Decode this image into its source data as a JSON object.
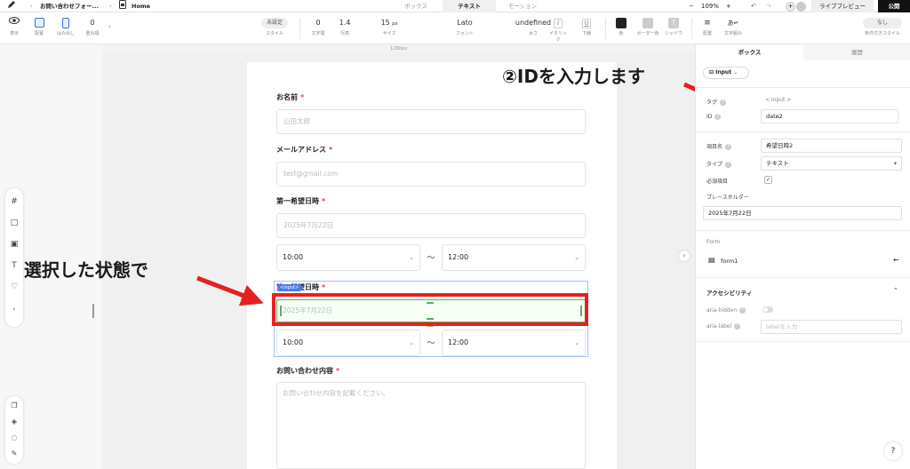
{
  "topbar": {
    "file_name": "お問い合わせフォー...",
    "page_name": "Home",
    "tabs": [
      "ボックス",
      "テキスト",
      "モーション"
    ],
    "active_tab": "テキスト",
    "zoom": "109%",
    "zoom_minus": "−",
    "zoom_plus": "+",
    "live_preview": "ライブプレビュー",
    "publish": "公開"
  },
  "toolbar": {
    "display_label": "表示",
    "layout_label": "配置",
    "overflow_label": "はみ出し",
    "stack_value": "0",
    "stack_label": "重ね順",
    "style_value": "未設定",
    "style_label": "スタイル",
    "letter_spacing_value": "0",
    "letter_spacing_label": "文字間",
    "line_height_value": "1.4",
    "line_height_label": "行高",
    "size_value": "15",
    "size_unit": "px",
    "size_label": "サイズ",
    "font_value": "Lato",
    "font_label": "フォント",
    "weight_value": "undefined",
    "weight_label": "太さ",
    "italic_label": "イタリック",
    "underline_label": "下線",
    "color_label": "色",
    "border_color_label": "ボーダー色",
    "shadow_label": "シャドウ",
    "align_label": "配置",
    "text_wrap_label": "文字組み",
    "condition_value": "なし",
    "condition_label": "条件付きスタイル"
  },
  "canvas": {
    "ruler_label": "1280px"
  },
  "form": {
    "name_label": "お名前",
    "name_placeholder": "山田太郎",
    "email_label": "メールアドレス",
    "email_placeholder": "test@gmail.com",
    "date1_label": "第一希望日時",
    "date1_placeholder": "2025年7月22日",
    "time1_start": "10:00",
    "time1_end": "12:00",
    "date2_label": "第二希望日時",
    "input_tag": "<input>",
    "date2_placeholder": "2025年7月22日",
    "time2_start": "10:00",
    "time2_end": "12:00",
    "tilde": "〜",
    "required_mark": "*",
    "content_label": "お問い合わせ内容",
    "content_placeholder": "お問い合わせ内容を記載ください。"
  },
  "annotations": {
    "step1": "①選択した状態で",
    "step2": "②IDを入力します"
  },
  "panel": {
    "tab_box": "ボックス",
    "tab_history": "履歴",
    "element_type": "Input",
    "tag_label": "タグ",
    "tag_value": "< input >",
    "id_label": "ID",
    "id_value": "date2",
    "field_name_label": "項目名",
    "field_name_value": "希望日時2",
    "type_label": "タイプ",
    "type_value": "テキスト",
    "required_label": "必須項目",
    "placeholder_label": "プレースホルダー",
    "placeholder_value": "2025年7月22日",
    "form_section": "Form",
    "form_name": "form1",
    "accessibility_section": "アクセシビリティ",
    "aria_hidden_label": "aria-hidden",
    "aria_label_label": "aria-label",
    "aria_label_placeholder": "labelを入力",
    "help": "?"
  },
  "colors": {
    "annotation_red": "#e62020",
    "selection_green": "#5bb05b",
    "selection_blue": "#4a7cf5",
    "required_red": "#e0453c",
    "publish_bg": "#111111"
  }
}
